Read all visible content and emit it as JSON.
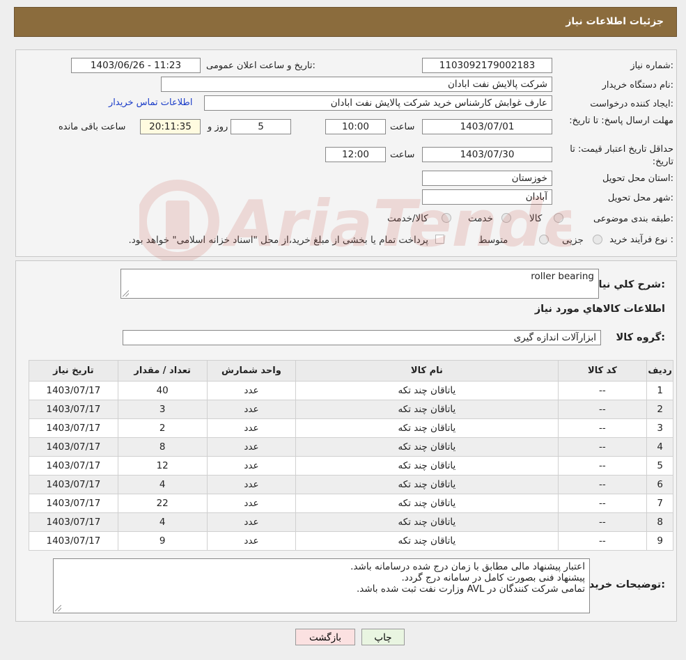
{
  "header": {
    "title": "جزئیات اطلاعات نیاز"
  },
  "form": {
    "need_number_label": "شماره نیاز:",
    "need_number": "1103092179002183",
    "announce_label": "تاریخ و ساعت اعلان عمومی:",
    "announce_value": "1403/06/26 - 11:23",
    "buyer_org_label": "نام دستگاه خریدار:",
    "buyer_org": "شرکت پالایش نفت ابادان",
    "creator_label": "ایجاد کننده درخواست:",
    "creator": "عارف غوابش کارشناس خرید شرکت پالایش نفت ابادان",
    "contact_link": "اطلاعات تماس خریدار",
    "deadline_label": "مهلت ارسال پاسخ: تا تاریخ:",
    "deadline_date": "1403/07/01",
    "time_label": "ساعت",
    "deadline_time": "10:00",
    "days": "5",
    "days_label": "روز و",
    "remaining": "20:11:35",
    "remaining_label": "ساعت باقی مانده",
    "validity_label": "حداقل تاریخ اعتبار قیمت: تا تاریخ:",
    "validity_date": "1403/07/30",
    "validity_time": "12:00",
    "province_label": "استان محل تحویل:",
    "province": "خوزستان",
    "city_label": "شهر محل تحویل:",
    "city": "آبادان",
    "category_label": "طبقه بندی موضوعی:",
    "category_options": [
      "کالا",
      "خدمت",
      "کالا/خدمت"
    ],
    "process_label": "نوع فرآیند خرید :",
    "process_options": [
      "جزیی",
      "متوسط"
    ],
    "payment_note": "پرداخت تمام یا بخشی از مبلغ خرید،از محل \"اسناد خزانه اسلامی\" خواهد بود."
  },
  "main": {
    "description_label": "شرح کلي نياز:",
    "description": "roller bearing",
    "items_title": "اطلاعات کالاهاي مورد نياز",
    "group_label": "گروه کالا:",
    "group_value": "ابزارآلات اندازه گیری",
    "columns": [
      "رديف",
      "کد کالا",
      "نام کالا",
      "واحد شمارش",
      "تعداد / مقدار",
      "تاریخ نیاز"
    ],
    "rows": [
      [
        "1",
        "--",
        "یاتاقان چند تکه",
        "عدد",
        "40",
        "1403/07/17"
      ],
      [
        "2",
        "--",
        "یاتاقان چند تکه",
        "عدد",
        "3",
        "1403/07/17"
      ],
      [
        "3",
        "--",
        "یاتاقان چند تکه",
        "عدد",
        "2",
        "1403/07/17"
      ],
      [
        "4",
        "--",
        "یاتاقان چند تکه",
        "عدد",
        "8",
        "1403/07/17"
      ],
      [
        "5",
        "--",
        "یاتاقان چند تکه",
        "عدد",
        "12",
        "1403/07/17"
      ],
      [
        "6",
        "--",
        "یاتاقان چند تکه",
        "عدد",
        "4",
        "1403/07/17"
      ],
      [
        "7",
        "--",
        "یاتاقان چند تکه",
        "عدد",
        "22",
        "1403/07/17"
      ],
      [
        "8",
        "--",
        "یاتاقان چند تکه",
        "عدد",
        "4",
        "1403/07/17"
      ],
      [
        "9",
        "--",
        "یاتاقان چند تکه",
        "عدد",
        "9",
        "1403/07/17"
      ]
    ],
    "notes_label": "توضیحات خریدار:",
    "notes": [
      "اعتبار پیشنهاد مالی مطابق با زمان درج شده درسامانه باشد.",
      "پیشنهاد فنی بصورت کامل در سامانه درج گردد.",
      "تمامی شرکت کنندگان در AVL وزارت نفت ثبت شده باشد."
    ]
  },
  "buttons": {
    "print": "چاپ",
    "back": "بازگشت"
  },
  "watermark": {
    "text": "AriaTender.neT",
    "color": "#c0392b"
  }
}
